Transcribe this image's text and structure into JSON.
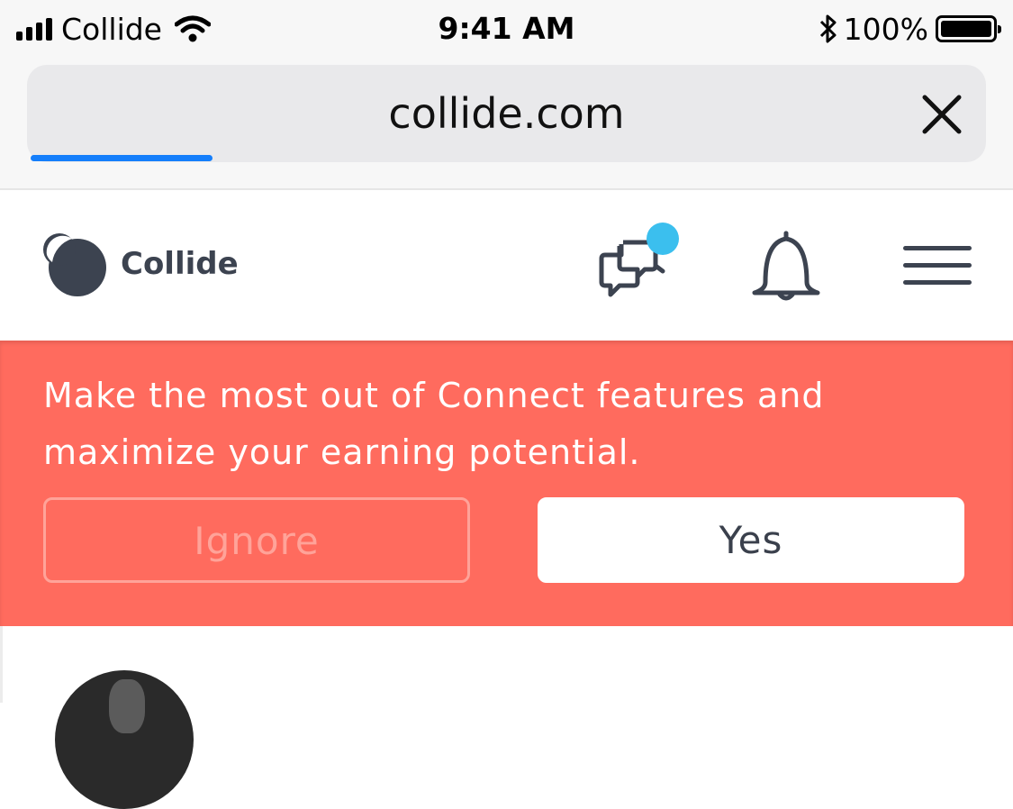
{
  "status_bar": {
    "carrier": "Collide",
    "time": "9:41 AM",
    "battery_percent": "100%",
    "icons": [
      "signal-icon",
      "wifi-icon",
      "bluetooth-icon",
      "battery-icon"
    ]
  },
  "browser": {
    "url": "collide.com",
    "load_progress": 0.19,
    "close_icon": "close-icon"
  },
  "header": {
    "logo_text": "Collide",
    "icons": [
      "chat-icon",
      "bell-icon",
      "menu-icon"
    ],
    "chat_badge_color": "#3bbfee"
  },
  "banner": {
    "message": "Make the most out of Connect features and maximize your earning potential.",
    "ignore_label": "Ignore",
    "yes_label": "Yes",
    "background_color": "#ff6b5e"
  },
  "colors": {
    "accent_blue": "#147efb",
    "text_dark": "#3c4350"
  }
}
